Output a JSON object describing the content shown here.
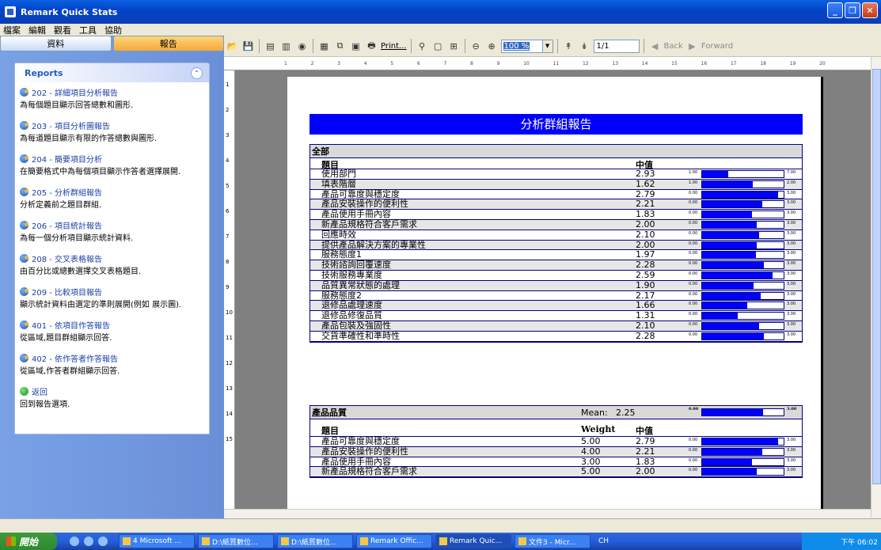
{
  "window": {
    "title": "Remark Quick Stats",
    "buttons": [
      "_",
      "❐",
      "✕"
    ]
  },
  "menu": [
    "檔案",
    "編輯",
    "觀看",
    "工具",
    "協助"
  ],
  "tabs": {
    "data": "資料",
    "report": "報告"
  },
  "reports": {
    "heading": "Reports",
    "items": [
      {
        "link": "202 - 詳細項目分析報告",
        "desc": "為每個題目顯示回答總數和圖形."
      },
      {
        "link": "203 - 項目分析圖報告",
        "desc": "為每道題目顯示有限的作答總數與圖形."
      },
      {
        "link": "204 - 簡要項目分析",
        "desc": "在簡要格式中為每個項目顯示作答者選擇展開."
      },
      {
        "link": "205 - 分析群組報告",
        "desc": "分析定義前之題目群組."
      },
      {
        "link": "206 - 項目統計報告",
        "desc": "為每一個分析項目顯示統計資料."
      },
      {
        "link": "208 - 交叉表格報告",
        "desc": "由百分比或總數選擇交叉表格題目."
      },
      {
        "link": "209 - 比較項目報告",
        "desc": "顯示統計資料由選定的準則展開(例如 展示圖)."
      },
      {
        "link": "401 - 依項目作答報告",
        "desc": "從區域,題目群組顯示回答."
      },
      {
        "link": "402 - 依作答者作答報告",
        "desc": "從區域,作答者群組顯示回答."
      },
      {
        "link": "返回",
        "desc": "回到報告選項."
      }
    ]
  },
  "toolbar": {
    "print": "Print...",
    "zoom": "100 %",
    "page": "1/1",
    "back": "Back",
    "forward": "Forward"
  },
  "ruler": [
    "1",
    "2",
    "3",
    "4",
    "5",
    "6",
    "7",
    "8",
    "9",
    "10",
    "11",
    "12",
    "13",
    "14",
    "15",
    "16",
    "17",
    "18",
    "19",
    "20"
  ],
  "vruler": [
    "1",
    "2",
    "3",
    "4",
    "5",
    "6",
    "7",
    "8",
    "9",
    "10",
    "11",
    "12",
    "13",
    "14",
    "15"
  ],
  "report": {
    "title": "分析群組報告",
    "sections": [
      {
        "name": "全部",
        "col_item": "題目",
        "col_median": "中值",
        "rows": [
          {
            "q": "使用部門",
            "v": "2.93",
            "min": "1.00",
            "max": "7.00",
            "frac": 0.32
          },
          {
            "q": "填表階層",
            "v": "1.62",
            "min": "1.00",
            "max": "2.00",
            "frac": 0.62
          },
          {
            "q": "產品可靠度與穩定度",
            "v": "2.79",
            "min": "0.00",
            "max": "3.00",
            "frac": 0.93
          },
          {
            "q": "產品安裝操作的便利性",
            "v": "2.21",
            "min": "0.00",
            "max": "3.00",
            "frac": 0.74
          },
          {
            "q": "產品使用手冊內容",
            "v": "1.83",
            "min": "0.00",
            "max": "3.00",
            "frac": 0.61
          },
          {
            "q": "新產品規格符合客戶需求",
            "v": "2.00",
            "min": "0.00",
            "max": "3.00",
            "frac": 0.67
          },
          {
            "q": "回應時效",
            "v": "2.10",
            "min": "0.00",
            "max": "3.00",
            "frac": 0.7
          },
          {
            "q": "提供產品解決方案的專業性",
            "v": "2.00",
            "min": "0.00",
            "max": "3.00",
            "frac": 0.67
          },
          {
            "q": "服務態度1",
            "v": "1.97",
            "min": "0.00",
            "max": "3.00",
            "frac": 0.66
          },
          {
            "q": "技術諮詢回覆速度",
            "v": "2.28",
            "min": "0.00",
            "max": "3.00",
            "frac": 0.76
          },
          {
            "q": "技術服務專業度",
            "v": "2.59",
            "min": "0.00",
            "max": "3.00",
            "frac": 0.86
          },
          {
            "q": "品質異常狀態的處理",
            "v": "1.90",
            "min": "0.00",
            "max": "3.00",
            "frac": 0.63
          },
          {
            "q": "服務態度2",
            "v": "2.17",
            "min": "0.00",
            "max": "3.00",
            "frac": 0.72
          },
          {
            "q": "退修品處理速度",
            "v": "1.66",
            "min": "0.00",
            "max": "3.00",
            "frac": 0.55
          },
          {
            "q": "退修品修復品質",
            "v": "1.31",
            "min": "0.00",
            "max": "3.00",
            "frac": 0.44
          },
          {
            "q": "產品包裝及強固性",
            "v": "2.10",
            "min": "0.00",
            "max": "3.00",
            "frac": 0.7
          },
          {
            "q": "交貨準確性和準時性",
            "v": "2.28",
            "min": "0.00",
            "max": "3.00",
            "frac": 0.76
          }
        ]
      },
      {
        "name": "產品品質",
        "mean_label": "Mean:",
        "mean": "2.25",
        "mean_min": "0.00",
        "mean_max": "3.00",
        "mean_frac": 0.75,
        "col_item": "題目",
        "col_weight": "Weight",
        "col_median": "中值",
        "rows": [
          {
            "q": "產品可靠度與穩定度",
            "w": "5.00",
            "v": "2.79",
            "min": "0.00",
            "max": "3.00",
            "frac": 0.93
          },
          {
            "q": "產品安裝操作的便利性",
            "w": "4.00",
            "v": "2.21",
            "min": "0.00",
            "max": "3.00",
            "frac": 0.74
          },
          {
            "q": "產品使用手冊內容",
            "w": "3.00",
            "v": "1.83",
            "min": "0.00",
            "max": "3.00",
            "frac": 0.61
          },
          {
            "q": "新產品規格符合客戶需求",
            "w": "5.00",
            "v": "2.00",
            "min": "0.00",
            "max": "3.00",
            "frac": 0.67
          }
        ]
      }
    ]
  },
  "taskbar": {
    "start": "開始",
    "buttons": [
      "4 Microsoft ...",
      "D:\\紙質數位...",
      "D:\\紙質數位...",
      "Remark Offic...",
      "Remark Quic...",
      "文件3 - Micr..."
    ],
    "lang": "CH",
    "clock": "下午 06:02"
  }
}
